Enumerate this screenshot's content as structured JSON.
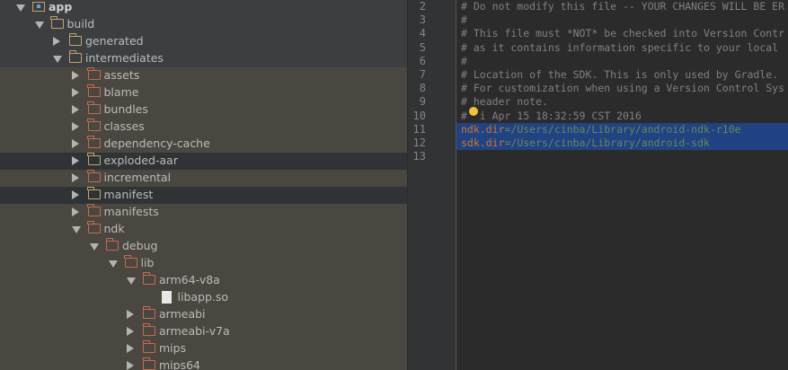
{
  "tree": [
    {
      "label": "app",
      "depth": 0,
      "arrow": "down",
      "icon": "module",
      "bold": true
    },
    {
      "label": "build",
      "depth": 1,
      "arrow": "down",
      "icon": "plain"
    },
    {
      "label": "generated",
      "depth": 2,
      "arrow": "right",
      "icon": "plain"
    },
    {
      "label": "intermediates",
      "depth": 2,
      "arrow": "down",
      "icon": "plain"
    },
    {
      "label": "assets",
      "depth": 3,
      "arrow": "right",
      "icon": "red",
      "hl": true
    },
    {
      "label": "blame",
      "depth": 3,
      "arrow": "right",
      "icon": "red",
      "hl": true
    },
    {
      "label": "bundles",
      "depth": 3,
      "arrow": "right",
      "icon": "red",
      "hl": true
    },
    {
      "label": "classes",
      "depth": 3,
      "arrow": "right",
      "icon": "red",
      "hl": true
    },
    {
      "label": "dependency-cache",
      "depth": 3,
      "arrow": "right",
      "icon": "red",
      "hl": true
    },
    {
      "label": "exploded-aar",
      "depth": 3,
      "arrow": "right",
      "icon": "plain",
      "sel": true
    },
    {
      "label": "incremental",
      "depth": 3,
      "arrow": "right",
      "icon": "red",
      "hl": true
    },
    {
      "label": "manifest",
      "depth": 3,
      "arrow": "right",
      "icon": "plain",
      "sel": true
    },
    {
      "label": "manifests",
      "depth": 3,
      "arrow": "right",
      "icon": "red",
      "hl": true
    },
    {
      "label": "ndk",
      "depth": 3,
      "arrow": "down",
      "icon": "red",
      "hl": true
    },
    {
      "label": "debug",
      "depth": 4,
      "arrow": "down",
      "icon": "red",
      "hl": true
    },
    {
      "label": "lib",
      "depth": 5,
      "arrow": "down",
      "icon": "red",
      "hl": true
    },
    {
      "label": "arm64-v8a",
      "depth": 6,
      "arrow": "down",
      "icon": "red",
      "hl": true
    },
    {
      "label": "libapp.so",
      "depth": 7,
      "arrow": "none",
      "icon": "file",
      "hl": true
    },
    {
      "label": "armeabi",
      "depth": 6,
      "arrow": "right",
      "icon": "red",
      "hl": true
    },
    {
      "label": "armeabi-v7a",
      "depth": 6,
      "arrow": "right",
      "icon": "red",
      "hl": true
    },
    {
      "label": "mips",
      "depth": 6,
      "arrow": "right",
      "icon": "red",
      "hl": true
    },
    {
      "label": "mips64",
      "depth": 6,
      "arrow": "right",
      "icon": "red",
      "hl": true
    }
  ],
  "editor": {
    "lines": [
      {
        "num": "2",
        "text": "# Do not modify this file -- YOUR CHANGES WILL BE ER"
      },
      {
        "num": "3",
        "text": "#"
      },
      {
        "num": "4",
        "text": "# This file must *NOT* be checked into Version Contr"
      },
      {
        "num": "5",
        "text": "# as it contains information specific to your local"
      },
      {
        "num": "6",
        "text": "#"
      },
      {
        "num": "7",
        "text": "# Location of the SDK. This is only used by Gradle."
      },
      {
        "num": "8",
        "text": "# For customization when using a Version Control Sys"
      },
      {
        "num": "9",
        "text": "# header note."
      },
      {
        "num": "10",
        "text": "#  i Apr 15 18:32:59 CST 2016"
      },
      {
        "num": "11",
        "key": "ndk.dir",
        "val": "=/Users/cinba/Library/android-ndk-r10e",
        "selected": true
      },
      {
        "num": "12",
        "key": "sdk.dir",
        "val": "=/Users/cinba/Library/android-sdk",
        "selected": true
      },
      {
        "num": "13",
        "text": ""
      }
    ]
  }
}
